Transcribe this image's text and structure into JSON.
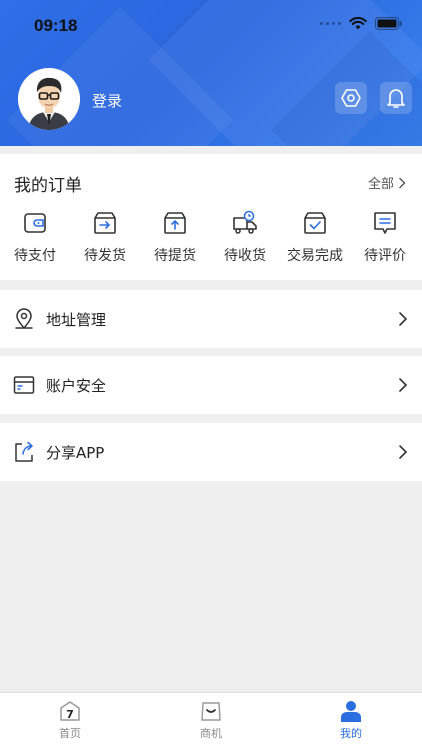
{
  "status_bar": {
    "time": "09:18"
  },
  "profile": {
    "login_label": "登录"
  },
  "orders": {
    "title": "我的订单",
    "all_label": "全部",
    "items": [
      {
        "label": "待支付",
        "icon": "wallet-icon"
      },
      {
        "label": "待发货",
        "icon": "box-out-icon"
      },
      {
        "label": "待提货",
        "icon": "box-up-icon"
      },
      {
        "label": "待收货",
        "icon": "truck-icon"
      },
      {
        "label": "交易完成",
        "icon": "box-check-icon"
      },
      {
        "label": "待评价",
        "icon": "comment-icon"
      }
    ]
  },
  "menu": [
    {
      "label": "地址管理",
      "icon": "location-icon"
    },
    {
      "label": "账户安全",
      "icon": "card-icon"
    },
    {
      "label": "分享APP",
      "icon": "share-icon"
    }
  ],
  "tabbar": {
    "items": [
      {
        "label": "首页",
        "icon_text": "7"
      },
      {
        "label": "商机"
      },
      {
        "label": "我的"
      }
    ],
    "active_color": "#2b6ee0"
  },
  "colors": {
    "header_blue": "#2f6ee6",
    "accent": "#2b6ee0"
  }
}
